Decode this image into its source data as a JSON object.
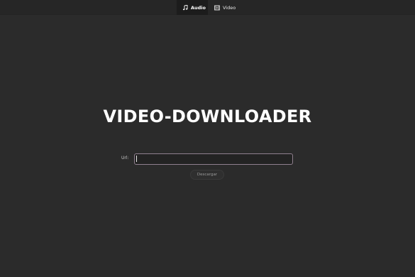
{
  "nav": {
    "tabs": [
      {
        "label": "Audio",
        "icon": "music-note-icon",
        "active": true
      },
      {
        "label": "Video",
        "icon": "film-icon",
        "active": false
      }
    ]
  },
  "main": {
    "title": "VIDEO-DOWNLOADER",
    "url_label": "Url:",
    "url_value": "",
    "submit_label": "Descargar"
  },
  "colors": {
    "background": "#2b2b2b",
    "topbar": "#262626",
    "active_tab": "#1c1c1c",
    "input_border": "#8f7f8e"
  }
}
